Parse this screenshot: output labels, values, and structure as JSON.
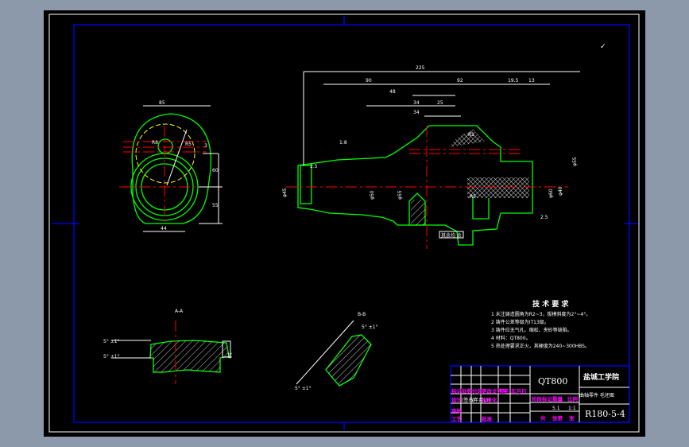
{
  "drawing": {
    "material": "QT800",
    "school": "盐城工学院",
    "part_name": "曲轴零件 毛坯图",
    "drawing_number": "R180-5-4",
    "tech_requirements_title": "技 术 要 求",
    "tech_requirements": [
      "1 未注铸造圆角为R2~3，拔模斜度为2°~4°。",
      "2 铸件公差等级为IT13级。",
      "3 铸件应无气孔、缩松、夹砂等缺陷。",
      "4 材料：QT800。",
      "5 热处理要求正火，其硬度为240~300HBS。"
    ],
    "title_block": {
      "row_labels": [
        "标记",
        "处数",
        "分区",
        "更改文件号",
        "签名",
        "年月日"
      ],
      "design_row": [
        "设计",
        "(签名)",
        "(年月日)",
        "标准化"
      ],
      "check_row": [
        "审核",
        "工艺"
      ],
      "approve": "批准",
      "stage_labels": [
        "阶段标记",
        "重量",
        "比例"
      ],
      "scale": "1:1",
      "weight": "5.1",
      "sheet_labels": [
        "共",
        "张第",
        "张"
      ]
    },
    "section_labels": [
      "A-A",
      "B-B"
    ],
    "dimensions": {
      "main_view": [
        "225",
        "90",
        "92",
        "19.5",
        "13",
        "48",
        "34",
        "25",
        "34",
        "2.5",
        "1:8",
        "2.5",
        "2.5",
        "2.5",
        "φ45",
        "φ50",
        "φ55",
        "φ60",
        "φ40",
        "φ45",
        "R1",
        "R5",
        "15",
        "φ55",
        "2.5",
        "2.5"
      ],
      "side_view": [
        "85",
        "60",
        "55",
        "44",
        "R8",
        "R5",
        "3"
      ],
      "section_aa": [
        "5° ±1°",
        "5° ±1°",
        "10"
      ],
      "section_bb": [
        "5° ±1°",
        "5° ±1°"
      ],
      "note_box": "其余均 余"
    },
    "check_mark": "✓",
    "colors": {
      "background": "#000000",
      "outline": "#00ff00",
      "centerline": "#ff0000",
      "dimension": "#ffffff",
      "frame": "#0000ff",
      "title_text": "#ff00ff",
      "hidden": "#ffff00",
      "window": "#8c99aa"
    }
  }
}
